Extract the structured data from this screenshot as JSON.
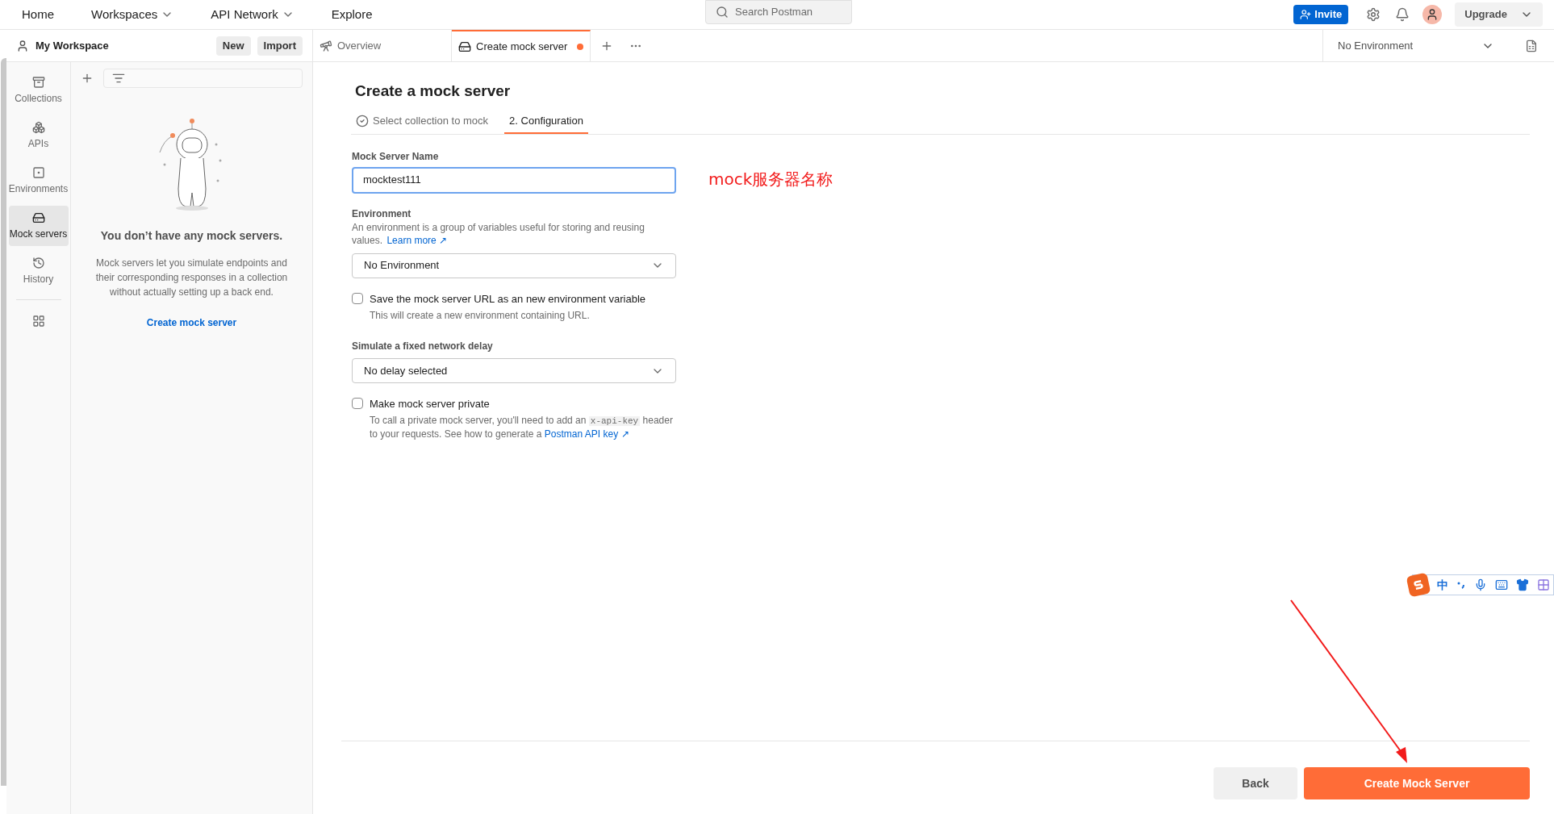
{
  "top_nav": {
    "items": [
      {
        "label": "Home",
        "has_menu": false
      },
      {
        "label": "Workspaces",
        "has_menu": true
      },
      {
        "label": "API Network",
        "has_menu": true
      },
      {
        "label": "Explore",
        "has_menu": false
      }
    ],
    "search": {
      "placeholder": "Search Postman"
    },
    "invite": "Invite",
    "upgrade": "Upgrade"
  },
  "workspace": {
    "name": "My Workspace",
    "buttons": [
      "New",
      "Import"
    ]
  },
  "tabs": [
    {
      "label": "Overview",
      "kind": "overview",
      "selected": false,
      "unsaved": false
    },
    {
      "label": "Create mock server",
      "kind": "mock",
      "selected": true,
      "unsaved": true
    }
  ],
  "environment_selector": "No Environment",
  "sidebar": {
    "items": [
      {
        "label": "Collections",
        "kind": "collections",
        "selected": false
      },
      {
        "label": "APIs",
        "kind": "apis",
        "selected": false
      },
      {
        "label": "Environments",
        "kind": "environments",
        "selected": false
      },
      {
        "label": "Mock servers",
        "kind": "mock",
        "selected": true
      },
      {
        "label": "History",
        "kind": "history",
        "selected": false
      }
    ]
  },
  "empty_state": {
    "title": "You don’t have any mock servers.",
    "text": "Mock servers let you simulate endpoints and their corresponding responses in a collection without actually setting up a back end.",
    "link": "Create mock server"
  },
  "page": {
    "title": "Create a mock server",
    "steps": [
      {
        "label": "Select collection to mock",
        "done": true,
        "selected": false
      },
      {
        "label": "2. Configuration",
        "done": false,
        "selected": true
      }
    ]
  },
  "form": {
    "name_label": "Mock Server Name",
    "name_value": "mocktest111",
    "annotation": "mock服务器名称",
    "environment_label": "Environment",
    "environment_help": "An environment is a group of variables useful for storing and reusing values.",
    "environment_link": "Learn more ↗",
    "environment_value": "No Environment",
    "save_url": {
      "label": "Save the mock server URL as an new environment variable",
      "help": "This will create a new environment containing URL.",
      "checked": false
    },
    "delay_label": "Simulate a fixed network delay",
    "delay_value": "No delay selected",
    "private": {
      "label": "Make mock server private",
      "help_before": "To call a private mock server, you'll need to add an",
      "code": "x-api-key",
      "help_after": "header to your requests. See how to generate a",
      "link": "Postman API key ↗",
      "checked": false
    }
  },
  "footer": {
    "back": "Back",
    "create": "Create Mock Server"
  },
  "ime_toolbar": {
    "mode": "中"
  }
}
